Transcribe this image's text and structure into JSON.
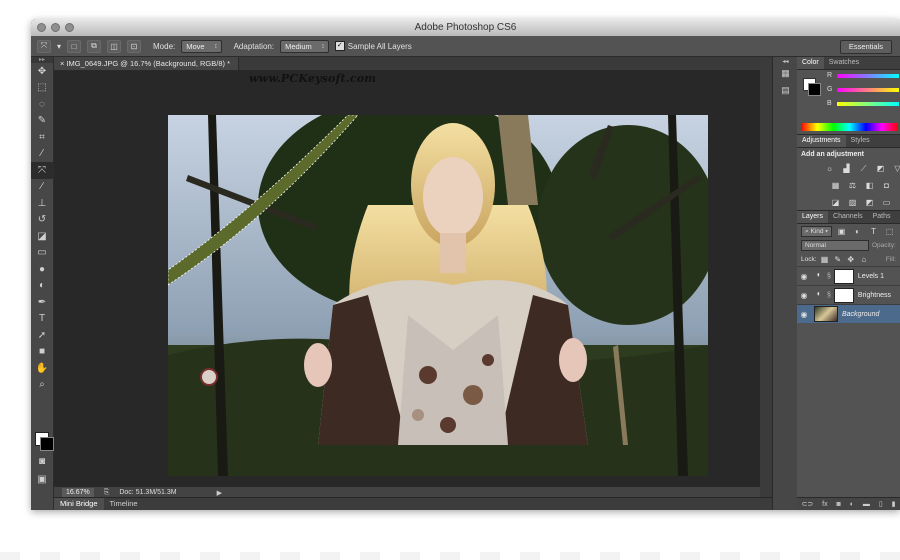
{
  "window": {
    "title": "Adobe Photoshop CS6"
  },
  "options_bar": {
    "mode_label": "Mode:",
    "mode_value": "Move",
    "adaptation_label": "Adaptation:",
    "adaptation_value": "Medium",
    "sample_all_layers_label": "Sample All Layers",
    "sample_all_layers_checked": true,
    "workspace": "Essentials"
  },
  "document": {
    "tab_label": "IMG_0649.JPG @ 16.7% (Background, RGB/8) *",
    "watermark": "www.PCKeysoft.com"
  },
  "status_bar": {
    "zoom": "16.67%",
    "doc_size": "Doc: 51.3M/51.3M"
  },
  "bottom_tabs": [
    "Mini Bridge",
    "Timeline"
  ],
  "panels": {
    "color_tabs": [
      "Color",
      "Swatches"
    ],
    "color_channels": [
      {
        "label": "R",
        "gradient": "linear-gradient(90deg,#000,#f00)"
      },
      {
        "label": "G",
        "gradient": "linear-gradient(90deg,#000,#0f0)"
      },
      {
        "label": "B",
        "gradient": "linear-gradient(90deg,#000,#00f)"
      }
    ],
    "adjustment_tabs": [
      "Adjustments",
      "Styles"
    ],
    "adjustments_title": "Add an adjustment",
    "layers_tabs": [
      "Layers",
      "Channels",
      "Paths"
    ],
    "kind_label": "Kind",
    "blend_mode": "Normal",
    "opacity_label": "Opacity:",
    "lock_label": "Lock:",
    "fill_label": "Fill:",
    "layers": [
      {
        "name": "Levels 1",
        "type": "adjustment",
        "selected": false
      },
      {
        "name": "Brightness",
        "type": "adjustment",
        "selected": false
      },
      {
        "name": "Background",
        "type": "image",
        "selected": true
      }
    ]
  },
  "colors": {
    "accent_selection": "#4c6a8c",
    "panel_bg": "#535353",
    "canvas_bg": "#282828"
  }
}
